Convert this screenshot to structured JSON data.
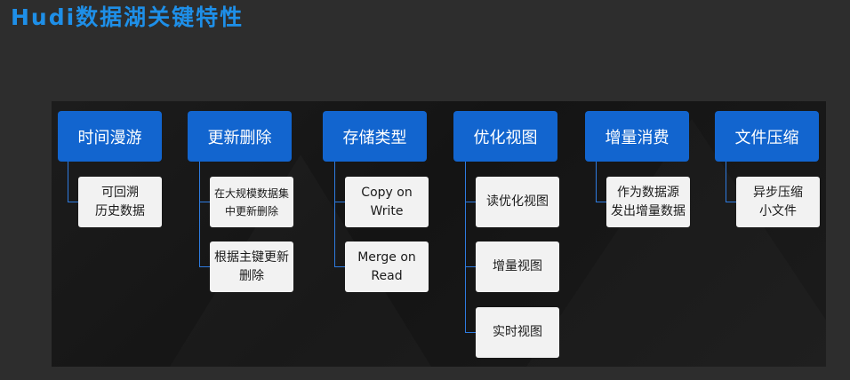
{
  "title": "Hudi数据湖关键特性",
  "columns": [
    {
      "header": "时间漫游",
      "items": [
        "可回溯\n历史数据"
      ]
    },
    {
      "header": "更新删除",
      "items": [
        "在大规模数据集\n中更新删除",
        "根据主键更新\n删除"
      ]
    },
    {
      "header": "存储类型",
      "items": [
        "Copy on\nWrite",
        "Merge on\nRead"
      ]
    },
    {
      "header": "优化视图",
      "items": [
        "读优化视图",
        "增量视图",
        "实时视图"
      ]
    },
    {
      "header": "增量消费",
      "items": [
        "作为数据源\n发出增量数据"
      ]
    },
    {
      "header": "文件压缩",
      "items": [
        "异步压缩\n小文件"
      ]
    }
  ],
  "colors": {
    "title": "#1e8fe8",
    "header_bg": "#1265cf",
    "item_bg": "#f2f2f2",
    "connector": "#2e7be0"
  }
}
